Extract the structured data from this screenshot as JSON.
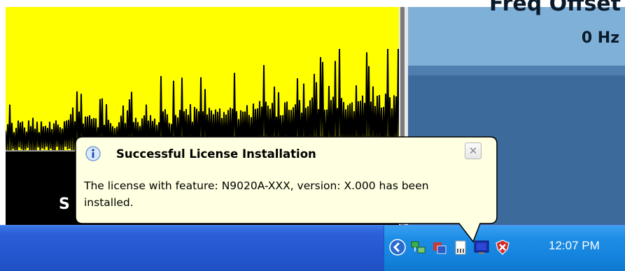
{
  "analyzer": {
    "trace_label": "S",
    "trace_colors": {
      "background": "#ffff00",
      "trace": "#000000",
      "lower": "#000000"
    },
    "readout": {
      "title": "Freq Offset",
      "value": "0 Hz"
    }
  },
  "notification": {
    "title": "Successful License Installation",
    "message": "The license with feature: N9020A-XXX, version: X.000 has been installed.",
    "close_symbol": "✕",
    "icon": "info-icon"
  },
  "taskbar": {
    "tray_icons": [
      "tray-expand-icon",
      "network-icon",
      "security-alert-icon",
      "license-manager-icon",
      "monitor-icon",
      "shield-icon"
    ],
    "clock": "12:07 PM"
  }
}
